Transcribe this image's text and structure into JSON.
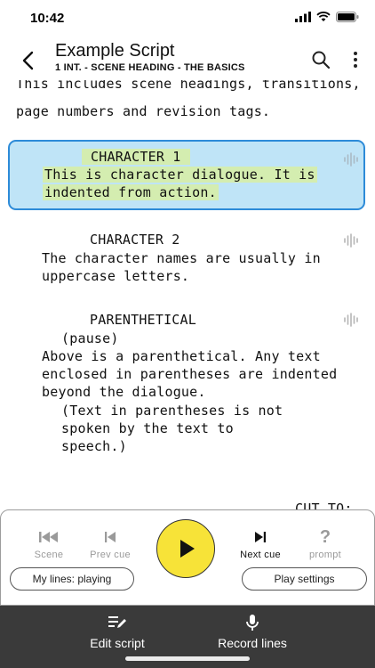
{
  "status": {
    "time": "10:42"
  },
  "header": {
    "title": "Example Script",
    "subtitle": "1 INT. - SCENE HEADING - THE BASICS"
  },
  "script": {
    "intro_lines": [
      "This includes scene headings, transitions,",
      "page numbers and revision tags."
    ],
    "block1": {
      "character": "CHARACTER 1",
      "dialogue": [
        "This is character dialogue. It is",
        "indented from action."
      ]
    },
    "block2": {
      "character": "CHARACTER 2",
      "dialogue": [
        "The character names are usually in",
        "uppercase letters."
      ]
    },
    "block3": {
      "character": "PARENTHETICAL",
      "paren": "(pause)",
      "dialogue": [
        "Above is a parenthetical. Any text",
        "enclosed in parentheses are indented",
        "beyond the dialogue."
      ],
      "paren2": [
        "(Text in parentheses is not",
        "spoken by the text to",
        "speech.)"
      ]
    },
    "transition": "CUT TO:"
  },
  "player": {
    "scene_label": "Scene",
    "prev_cue_label": "Prev cue",
    "next_cue_label": "Next cue",
    "prompt_label": "prompt",
    "my_lines_label": "My lines: playing",
    "play_settings_label": "Play settings",
    "accent_color": "#f7e338"
  },
  "bottombar": {
    "edit_label": "Edit script",
    "record_label": "Record lines"
  }
}
